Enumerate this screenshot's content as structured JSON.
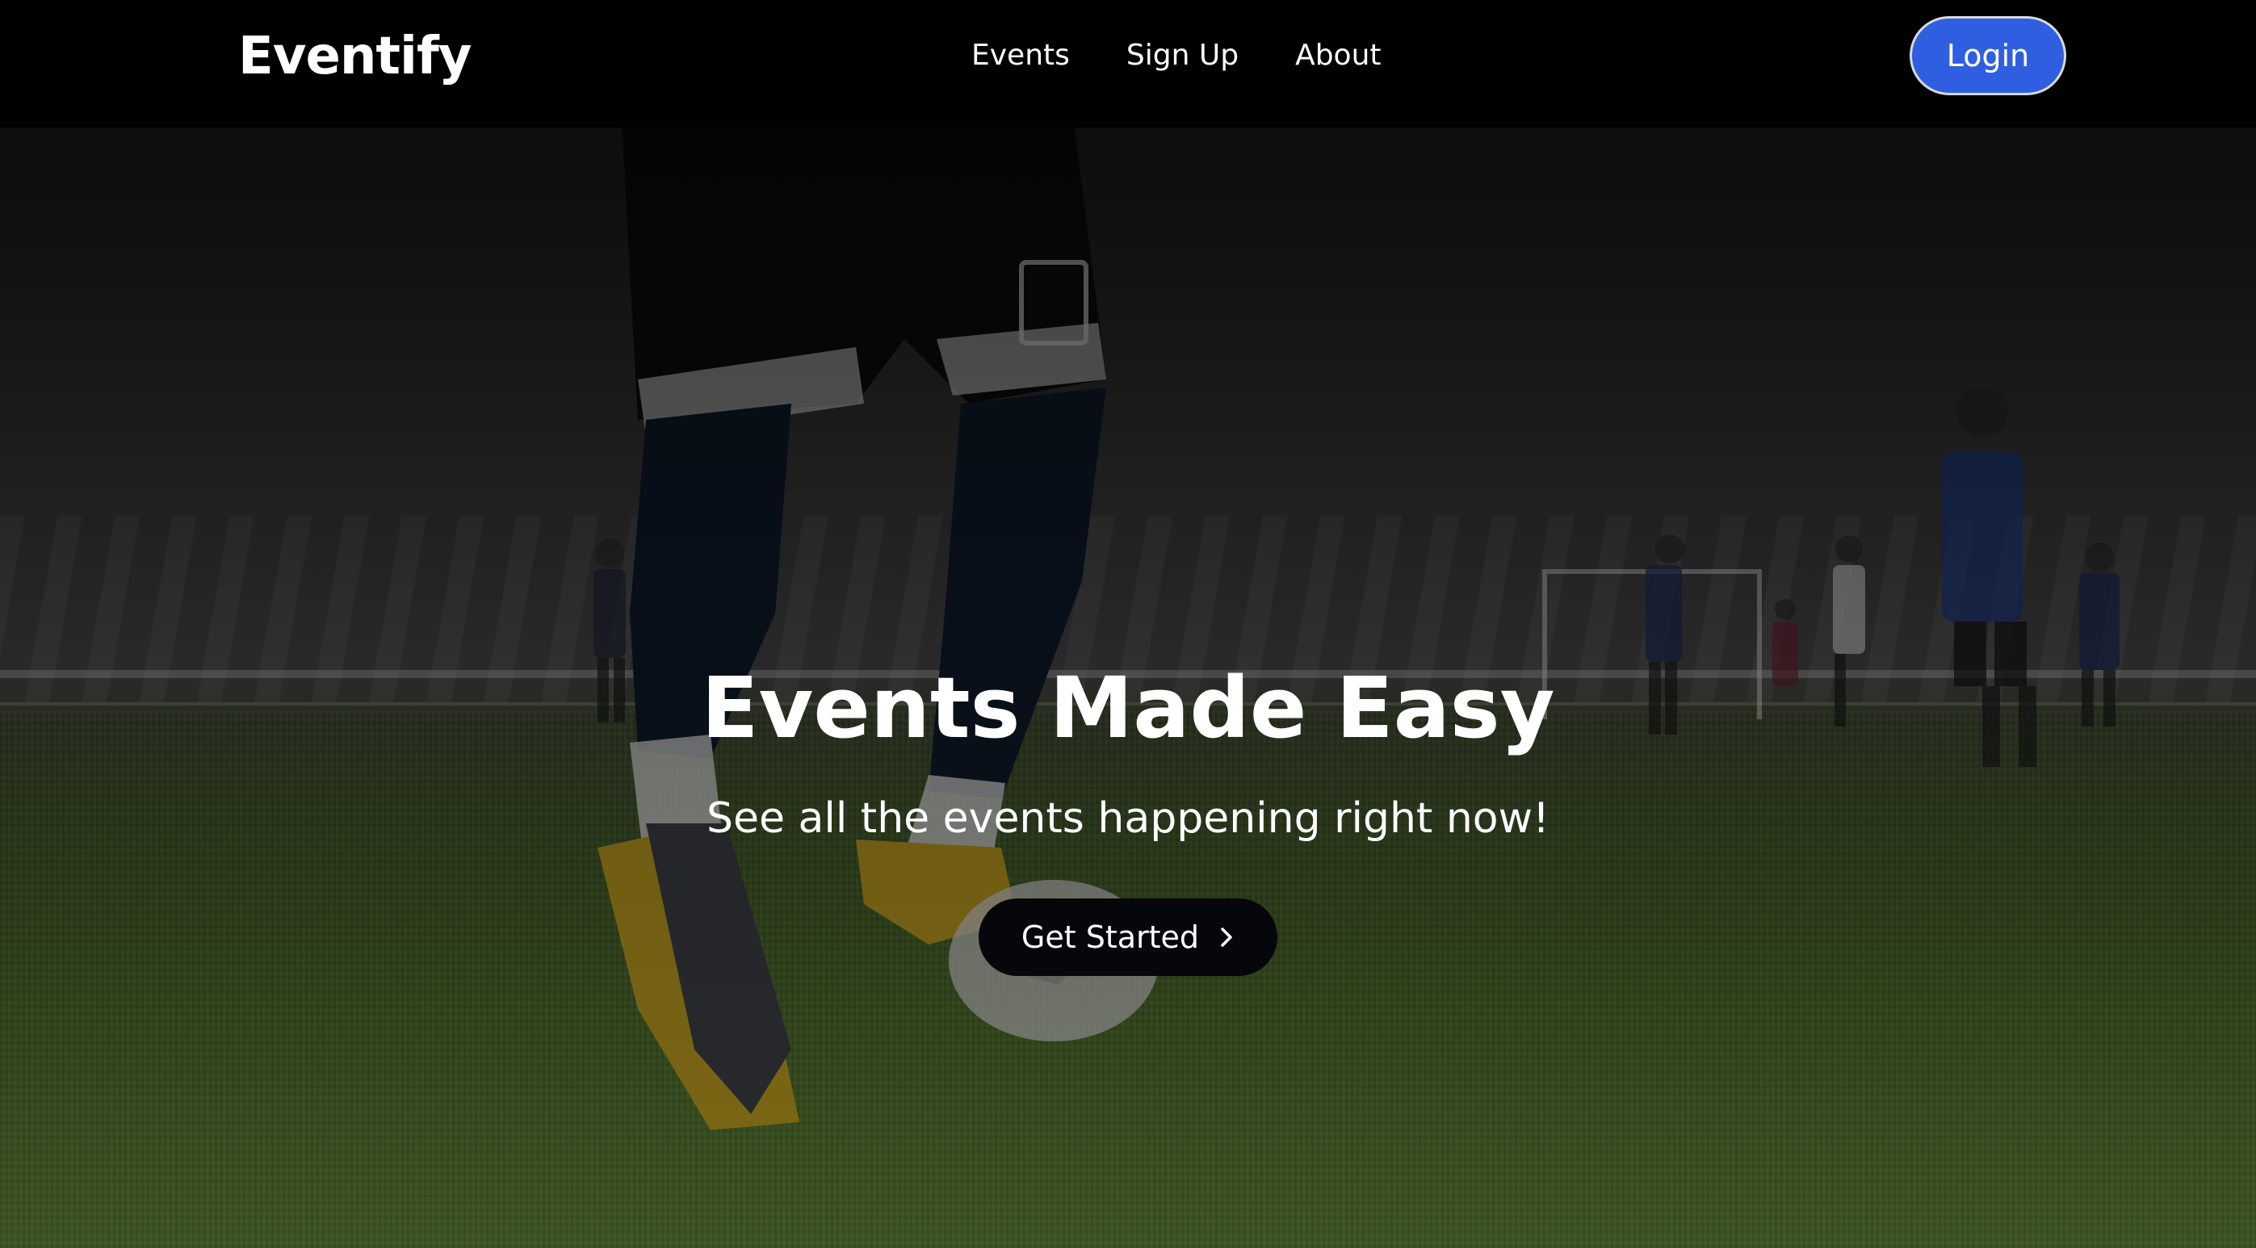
{
  "brand": {
    "name": "Eventify"
  },
  "nav": {
    "links": [
      {
        "label": "Events"
      },
      {
        "label": "Sign Up"
      },
      {
        "label": "About"
      }
    ],
    "login_label": "Login"
  },
  "hero": {
    "title": "Events Made Easy",
    "subtitle": "See all the events happening right now!",
    "cta_label": "Get Started",
    "cta_icon": "chevron-right-icon"
  },
  "colors": {
    "login_button": "#2f5fe0",
    "cta_button": "#05070b",
    "nav_background": "#000000",
    "text": "#ffffff"
  }
}
